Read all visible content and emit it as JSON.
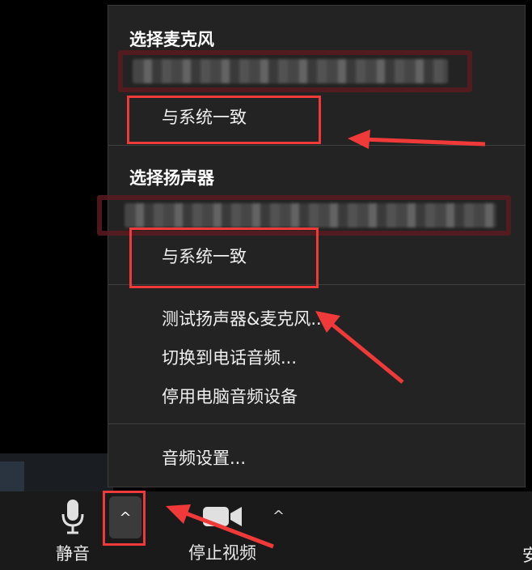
{
  "menu": {
    "microphone_section": {
      "title": "选择麦克风",
      "same_as_system": "与系统一致"
    },
    "speaker_section": {
      "title": "选择扬声器",
      "same_as_system": "与系统一致"
    },
    "actions": {
      "test": "测试扬声器&麦克风...",
      "switch_phone": "切换到电话音频...",
      "disable_pc_audio": "停用电脑音频设备"
    },
    "settings": "音频设置..."
  },
  "toolbar": {
    "mute_label": "静音",
    "caret_glyph": "^",
    "stop_video_label": "停止视频",
    "video_caret_glyph": "^",
    "truncated_label": "安"
  },
  "colors": {
    "menu_bg": "#232323",
    "annotation_red": "#f03a3a",
    "redaction_frame": "#5a1a1f"
  }
}
